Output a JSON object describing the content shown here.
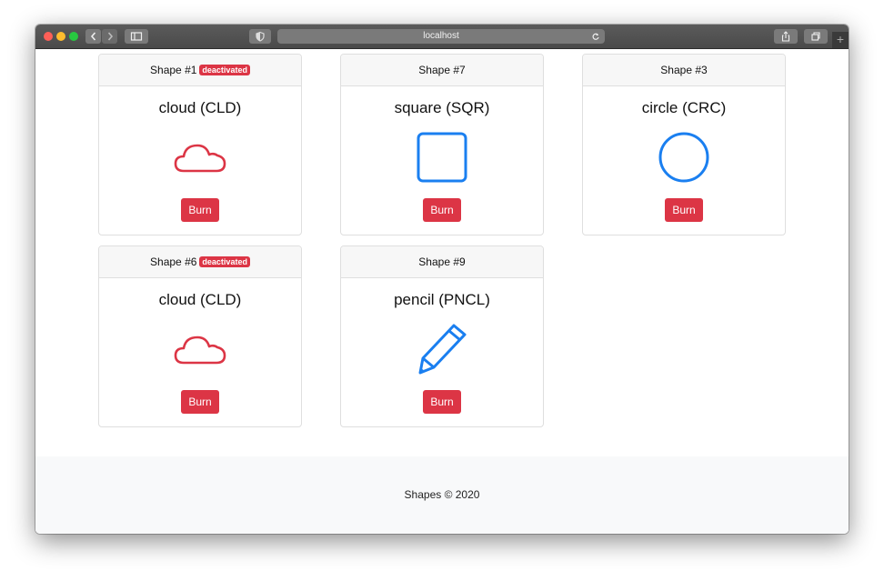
{
  "browser": {
    "url": "localhost",
    "icons": [
      "back-icon",
      "forward-icon",
      "sidebar-icon",
      "shield-icon",
      "reload-icon",
      "share-icon",
      "tabs-icon",
      "plus-icon"
    ]
  },
  "colors": {
    "danger": "#dc3545",
    "primary": "#1a7ff0"
  },
  "cards": [
    {
      "header": "Shape #1",
      "badge": "deactivated",
      "title": "cloud (CLD)",
      "icon": "cloud-icon",
      "color": "#dc3545",
      "button": "Burn"
    },
    {
      "header": "Shape #7",
      "badge": "",
      "title": "square (SQR)",
      "icon": "square-icon",
      "color": "#1a7ff0",
      "button": "Burn"
    },
    {
      "header": "Shape #3",
      "badge": "",
      "title": "circle (CRC)",
      "icon": "circle-icon",
      "color": "#1a7ff0",
      "button": "Burn"
    },
    {
      "header": "Shape #6",
      "badge": "deactivated",
      "title": "cloud (CLD)",
      "icon": "cloud-icon",
      "color": "#dc3545",
      "button": "Burn"
    },
    {
      "header": "Shape #9",
      "badge": "",
      "title": "pencil (PNCL)",
      "icon": "pencil-icon",
      "color": "#1a7ff0",
      "button": "Burn"
    }
  ],
  "footer": {
    "text": "Shapes © 2020"
  }
}
